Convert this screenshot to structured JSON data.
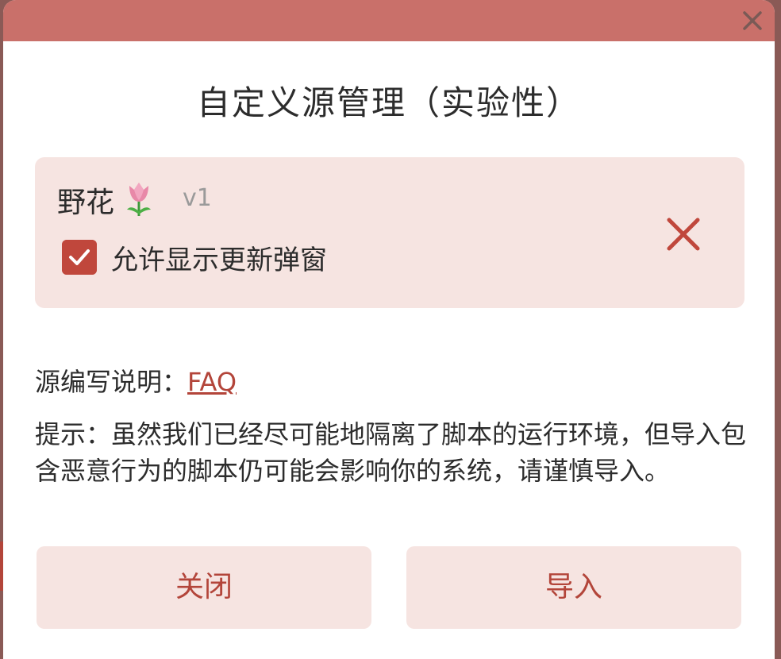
{
  "dialog": {
    "title": "自定义源管理（实验性）",
    "header_color": "#c9706a",
    "accent_color": "#b3453a",
    "close_icon": "close-icon"
  },
  "source": {
    "name": "野花",
    "icon": "tulip-icon",
    "version": "v1",
    "allow_update_popup": {
      "label": "允许显示更新弹窗",
      "checked": true
    },
    "remove_icon": "remove-icon"
  },
  "faq": {
    "label": "源编写说明：",
    "link_text": "FAQ"
  },
  "hint": "提示：虽然我们已经尽可能地隔离了脚本的运行环境，但导入包含恶意行为的脚本仍可能会影响你的系统，请谨慎导入。",
  "buttons": {
    "close_label": "关闭",
    "import_label": "导入"
  }
}
